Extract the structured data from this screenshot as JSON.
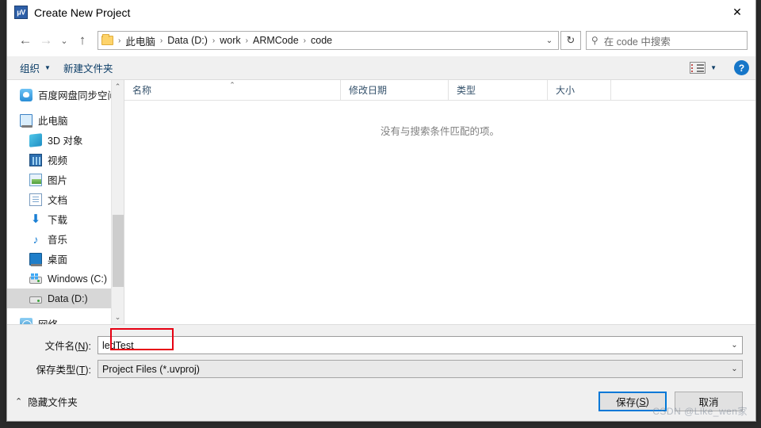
{
  "window": {
    "title": "Create New Project",
    "icon": "keil-uvision-icon",
    "close_label": "✕"
  },
  "nav": {
    "back": "←",
    "forward": "→",
    "recent": "⌄",
    "up": "↑",
    "refresh": "↻",
    "breadcrumb": [
      "此电脑",
      "Data (D:)",
      "work",
      "ARMCode",
      "code"
    ],
    "breadcrumb_separator": "›",
    "breadcrumb_dropdown": "⌄"
  },
  "search": {
    "placeholder": "在 code 中搜索",
    "icon": "search-icon"
  },
  "toolbar": {
    "organize": "组织",
    "organize_caret": "▼",
    "new_folder": "新建文件夹",
    "view_caret": "▼",
    "help": "?"
  },
  "sidebar": {
    "items": [
      {
        "label": "百度网盘同步空间",
        "icon": "baidu-netdisk-icon",
        "indent": false,
        "selected": false,
        "gap": false
      },
      {
        "label": "此电脑",
        "icon": "this-pc-icon",
        "indent": false,
        "selected": false,
        "gap": true
      },
      {
        "label": "3D 对象",
        "icon": "3d-objects-icon",
        "indent": true,
        "selected": false,
        "gap": false
      },
      {
        "label": "视频",
        "icon": "videos-icon",
        "indent": true,
        "selected": false,
        "gap": false
      },
      {
        "label": "图片",
        "icon": "pictures-icon",
        "indent": true,
        "selected": false,
        "gap": false
      },
      {
        "label": "文档",
        "icon": "documents-icon",
        "indent": true,
        "selected": false,
        "gap": false
      },
      {
        "label": "下载",
        "icon": "downloads-icon",
        "indent": true,
        "selected": false,
        "gap": false
      },
      {
        "label": "音乐",
        "icon": "music-icon",
        "indent": true,
        "selected": false,
        "gap": false
      },
      {
        "label": "桌面",
        "icon": "desktop-icon",
        "indent": true,
        "selected": false,
        "gap": false
      },
      {
        "label": "Windows (C:)",
        "icon": "windows-drive-icon",
        "indent": true,
        "selected": false,
        "gap": false
      },
      {
        "label": "Data (D:)",
        "icon": "drive-icon",
        "indent": true,
        "selected": true,
        "gap": false
      },
      {
        "label": "网络",
        "icon": "network-icon",
        "indent": false,
        "selected": false,
        "gap": true
      }
    ],
    "scroll_up": "⌃",
    "scroll_down": "⌄"
  },
  "filelist": {
    "columns": [
      {
        "label": "名称",
        "sorted": true,
        "sort_caret": "⌃"
      },
      {
        "label": "修改日期",
        "sorted": false,
        "sort_caret": ""
      },
      {
        "label": "类型",
        "sorted": false,
        "sort_caret": ""
      },
      {
        "label": "大小",
        "sorted": false,
        "sort_caret": ""
      }
    ],
    "rows": [],
    "empty_message": "没有与搜索条件匹配的项。"
  },
  "form": {
    "filename_label_pre": "文件名(",
    "filename_label_key": "N",
    "filename_label_post": "):",
    "filename_value": "ledTest",
    "filetype_label_pre": "保存类型(",
    "filetype_label_key": "T",
    "filetype_label_post": "):",
    "filetype_value": "Project Files (*.uvproj)",
    "dropdown_caret": "⌄",
    "annotation_color": "#e60012"
  },
  "footer": {
    "hide_folders_chevron": "⌃",
    "hide_folders": "隐藏文件夹",
    "save_pre": "保存(",
    "save_key": "S",
    "save_post": ")",
    "cancel": "取消"
  },
  "watermark": {
    "text": "CSDN @Like_wen家"
  }
}
